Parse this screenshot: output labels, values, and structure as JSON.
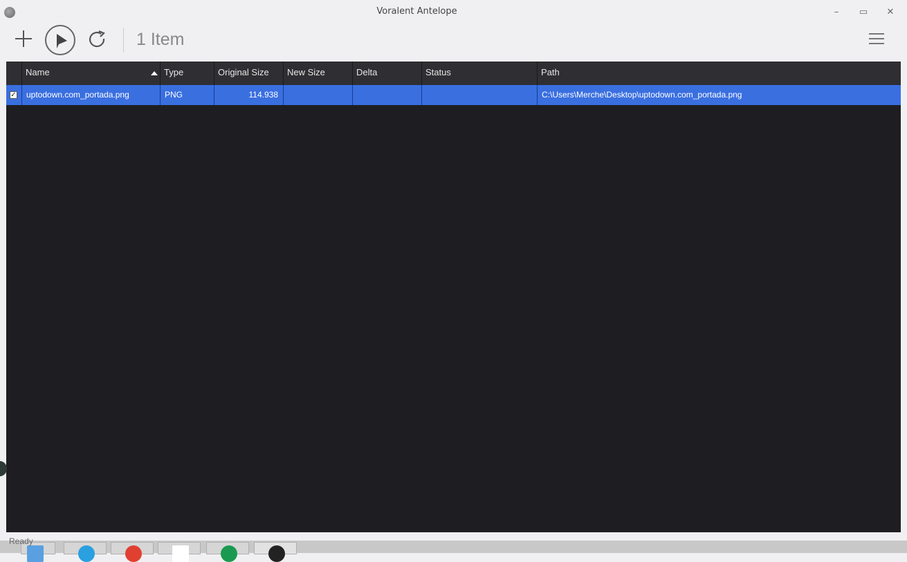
{
  "window": {
    "title": "Voralent Antelope",
    "controls": {
      "minimize": "–",
      "maximize": "▭",
      "close": "✕"
    }
  },
  "toolbar": {
    "add_icon": "plus-icon",
    "start_icon": "play-icon",
    "refresh_icon": "refresh-icon",
    "item_count": "1 Item",
    "menu_icon": "hamburger-menu-icon"
  },
  "grid": {
    "columns": [
      "Name",
      "Type",
      "Original Size",
      "New Size",
      "Delta",
      "Status",
      "Path"
    ],
    "sort_column": "Name",
    "sort_direction": "ascending",
    "rows": [
      {
        "checked": true,
        "name": "uptodown.com_portada.png",
        "type": "PNG",
        "original_size": "114.938",
        "new_size": "",
        "delta": "",
        "status": "",
        "path": "C:\\Users\\Merche\\Desktop\\uptodown.com_portada.png"
      }
    ]
  },
  "statusbar": {
    "text": "Ready"
  },
  "colors": {
    "selection": "#3a6fe0",
    "grid_bg": "#1e1e22",
    "header_bg": "#2f2f33"
  }
}
